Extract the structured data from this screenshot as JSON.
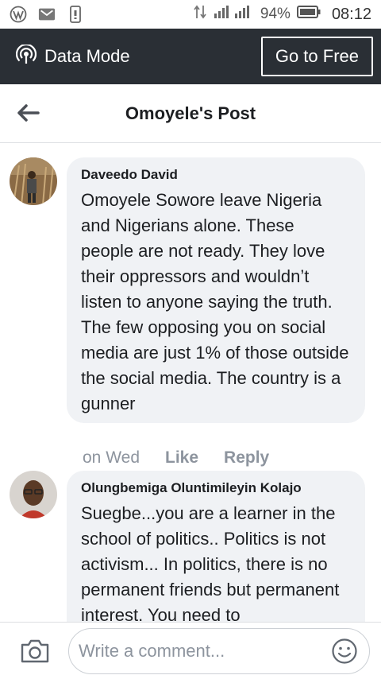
{
  "status_bar": {
    "battery": "94%",
    "time": "08:12",
    "icons": [
      "wordpress-icon",
      "gmail-icon",
      "phone-icon",
      "data-arrows-icon",
      "signal-icon",
      "battery-icon"
    ]
  },
  "data_mode": {
    "label": "Data Mode",
    "button": "Go to Free"
  },
  "header": {
    "title": "Omoyele's Post"
  },
  "comments": [
    {
      "author": "Daveedo David",
      "text": "Omoyele Sowore leave Nigeria and Nigerians alone. These people are not ready. They love their oppressors and wouldn’t listen to anyone saying the truth. The few opposing you on social media are just 1% of those outside the social media. The country is a gunner",
      "time": "on Wed",
      "like": "Like",
      "reply": "Reply"
    },
    {
      "author": "Olungbemiga Oluntimileyin Kolajo",
      "text": "Suegbe...you are a learner in the school of politics.. Politics is not activism... In politics, there is no permanent friends but permanent interest. You need to"
    }
  ],
  "composer": {
    "placeholder": "Write a comment..."
  },
  "colors": {
    "data_bar": "#2a2f35",
    "bubble": "#f0f2f5",
    "meta_text": "#8d949e"
  }
}
